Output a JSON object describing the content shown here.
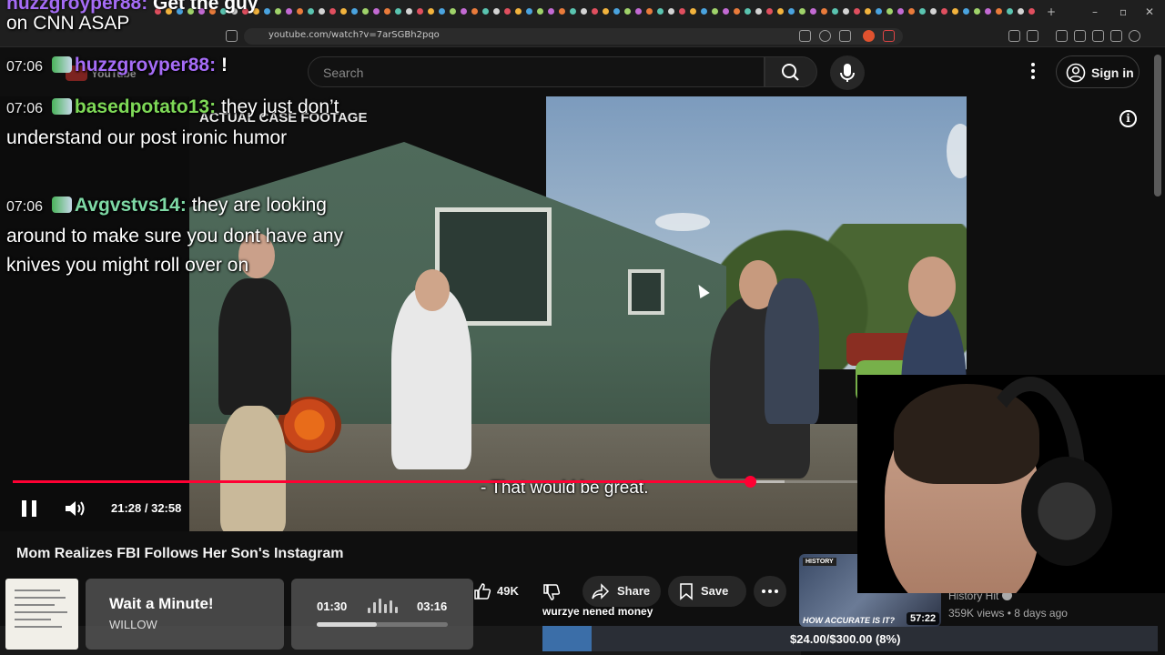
{
  "browser": {
    "url": "youtube.com/watch?v=7arSGBh2pqo"
  },
  "masthead": {
    "logo_text": "YouTube",
    "search_placeholder": "Search",
    "sign_in_label": "Sign in"
  },
  "video": {
    "overlay_label": "ACTUAL CASE FOOTAGE",
    "caption": "- That would be great.",
    "time_current": "21:28",
    "time_total": "32:58",
    "time_display": "21:28 / 32:58",
    "progress_fraction": 0.652,
    "buffer_fraction": 0.683
  },
  "chat": {
    "top_partial_name": "huzzgroyper88:",
    "top_partial_text": "Get the guy",
    "continuation": "on CNN ASAP",
    "messages": [
      {
        "time": "07:06",
        "user": "huzzgroyper88:",
        "text": "!",
        "color": "#a56cf6"
      },
      {
        "time": "07:06",
        "user": "basedpotato13:",
        "text": "they just don’t understand our post ironic humor",
        "color": "#7ed957"
      },
      {
        "time": "07:06",
        "user": "Avgvstvs14:",
        "text": "they are looking around to make sure you dont have any knives you might roll over on",
        "color": "#7ed9a5"
      }
    ]
  },
  "below": {
    "title": "Mom Realizes FBI Follows Her Son's Instagram",
    "like_count": "49K",
    "share_label": "Share",
    "save_label": "Save"
  },
  "now_playing": {
    "title": "Wait a Minute!",
    "artist": "WILLOW",
    "current": "01:30",
    "duration": "03:16",
    "progress_fraction": 0.46
  },
  "donation": {
    "text": "wurzye nened money",
    "goal_label": "$24.00/$300.00 (8%)",
    "fraction": 0.08
  },
  "recommendation": {
    "badge": "HISTORY",
    "thumb_caption": "HOW ACCURATE IS IT?",
    "duration": "57:22",
    "channel": "History Hit",
    "meta": "359K views • 8 days ago"
  }
}
